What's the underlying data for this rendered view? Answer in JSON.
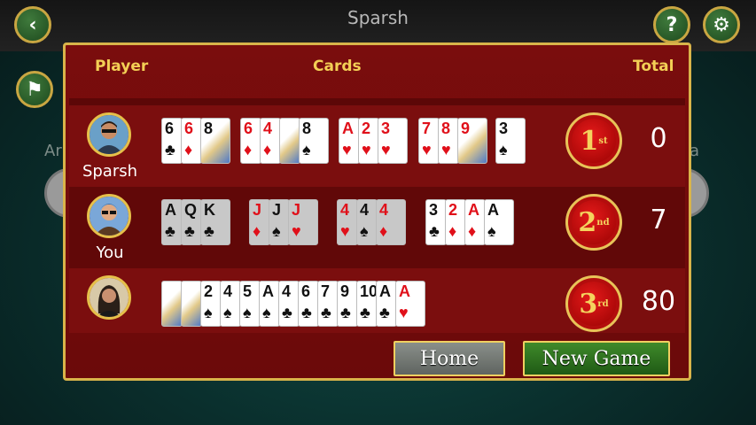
{
  "background": {
    "title": "Sparsh",
    "left_partial_label": "Ar",
    "right_partial_label": "a"
  },
  "icons": {
    "back": "back-arrow-icon",
    "help": "question-icon",
    "settings": "gear-icon",
    "flag": "flag-icon"
  },
  "help_glyph": "?",
  "back_glyph": "‹",
  "settings_glyph": "⚙",
  "flag_glyph": "⚑",
  "dialog": {
    "headers": {
      "player": "Player",
      "cards": "Cards",
      "total": "Total"
    },
    "rows": [
      {
        "name": "Sparsh",
        "place": "1",
        "place_suffix": "st",
        "total": "0",
        "groups": [
          [
            {
              "r": "6",
              "s": "♣",
              "c": "blk"
            },
            {
              "r": "6",
              "s": "♦",
              "c": "red"
            },
            {
              "r": "8",
              "s": "",
              "c": "blk",
              "face": true
            }
          ],
          [
            {
              "r": "6",
              "s": "♦",
              "c": "red"
            },
            {
              "r": "4",
              "s": "♦",
              "c": "red"
            },
            {
              "r": "",
              "s": "",
              "c": "blk",
              "face": true
            },
            {
              "r": "8",
              "s": "♠",
              "c": "blk"
            }
          ],
          [
            {
              "r": "A",
              "s": "♥",
              "c": "red"
            },
            {
              "r": "2",
              "s": "♥",
              "c": "red"
            },
            {
              "r": "3",
              "s": "♥",
              "c": "red"
            }
          ],
          [
            {
              "r": "7",
              "s": "♥",
              "c": "red"
            },
            {
              "r": "8",
              "s": "♥",
              "c": "red"
            },
            {
              "r": "9",
              "s": "",
              "c": "red",
              "face": true
            }
          ],
          [
            {
              "r": "3",
              "s": "♠",
              "c": "blk"
            }
          ]
        ]
      },
      {
        "name": "You",
        "place": "2",
        "place_suffix": "nd",
        "total": "7",
        "groups": [
          [
            {
              "r": "A",
              "s": "♣",
              "c": "blk",
              "gray": true
            },
            {
              "r": "Q",
              "s": "♣",
              "c": "blk",
              "gray": true
            },
            {
              "r": "K",
              "s": "♣",
              "c": "blk",
              "gray": true
            }
          ],
          [
            {
              "r": "J",
              "s": "♦",
              "c": "red",
              "gray": true
            },
            {
              "r": "J",
              "s": "♠",
              "c": "blk",
              "gray": true
            },
            {
              "r": "J",
              "s": "♥",
              "c": "red",
              "gray": true
            }
          ],
          [
            {
              "r": "4",
              "s": "♥",
              "c": "red",
              "gray": true
            },
            {
              "r": "4",
              "s": "♠",
              "c": "blk",
              "gray": true
            },
            {
              "r": "4",
              "s": "♦",
              "c": "red",
              "gray": true
            }
          ],
          [
            {
              "r": "3",
              "s": "♣",
              "c": "blk"
            },
            {
              "r": "2",
              "s": "♦",
              "c": "red"
            },
            {
              "r": "A",
              "s": "♦",
              "c": "red"
            },
            {
              "r": "A",
              "s": "♠",
              "c": "blk"
            }
          ]
        ]
      },
      {
        "name": "",
        "place": "3",
        "place_suffix": "rd",
        "total": "80",
        "groups": [
          [
            {
              "r": "",
              "s": "",
              "c": "blk",
              "face": true
            },
            {
              "r": "",
              "s": "",
              "c": "blk",
              "face": true
            },
            {
              "r": "2",
              "s": "♠",
              "c": "blk"
            },
            {
              "r": "4",
              "s": "♠",
              "c": "blk"
            },
            {
              "r": "5",
              "s": "♠",
              "c": "blk"
            },
            {
              "r": "A",
              "s": "♠",
              "c": "blk"
            },
            {
              "r": "4",
              "s": "♣",
              "c": "blk"
            },
            {
              "r": "6",
              "s": "♣",
              "c": "blk"
            },
            {
              "r": "7",
              "s": "♣",
              "c": "blk"
            },
            {
              "r": "9",
              "s": "♣",
              "c": "blk"
            },
            {
              "r": "10",
              "s": "♣",
              "c": "blk"
            },
            {
              "r": "A",
              "s": "♣",
              "c": "blk"
            },
            {
              "r": "A",
              "s": "♥",
              "c": "red"
            }
          ]
        ]
      }
    ],
    "buttons": {
      "home": "Home",
      "new_game": "New Game"
    }
  }
}
